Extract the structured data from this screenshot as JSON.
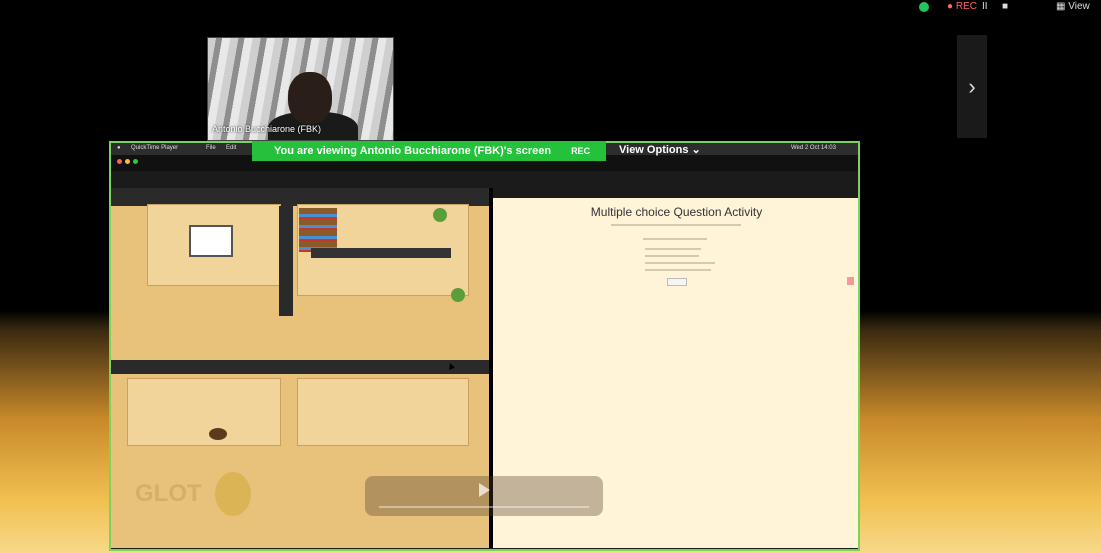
{
  "zoom": {
    "rec_label": "REC",
    "pause_label": "II",
    "view_label": "View",
    "participant_name": "Antonio Bucchiarone (FBK)",
    "banner_text": "You are viewing  Antonio Bucchiarone (FBK)'s screen",
    "banner_rec": "REC",
    "view_options": "View Options",
    "next_arrow": "›"
  },
  "mac": {
    "app": "QuickTime Player",
    "menu": [
      "File",
      "Edit"
    ],
    "clock": "Wed 2 Oct  14:03"
  },
  "quiz": {
    "title": "Multiple choice Question Activity"
  },
  "colors": {
    "banner": "#23c23a",
    "border": "#7dd35a",
    "shield": "#22c55e"
  }
}
